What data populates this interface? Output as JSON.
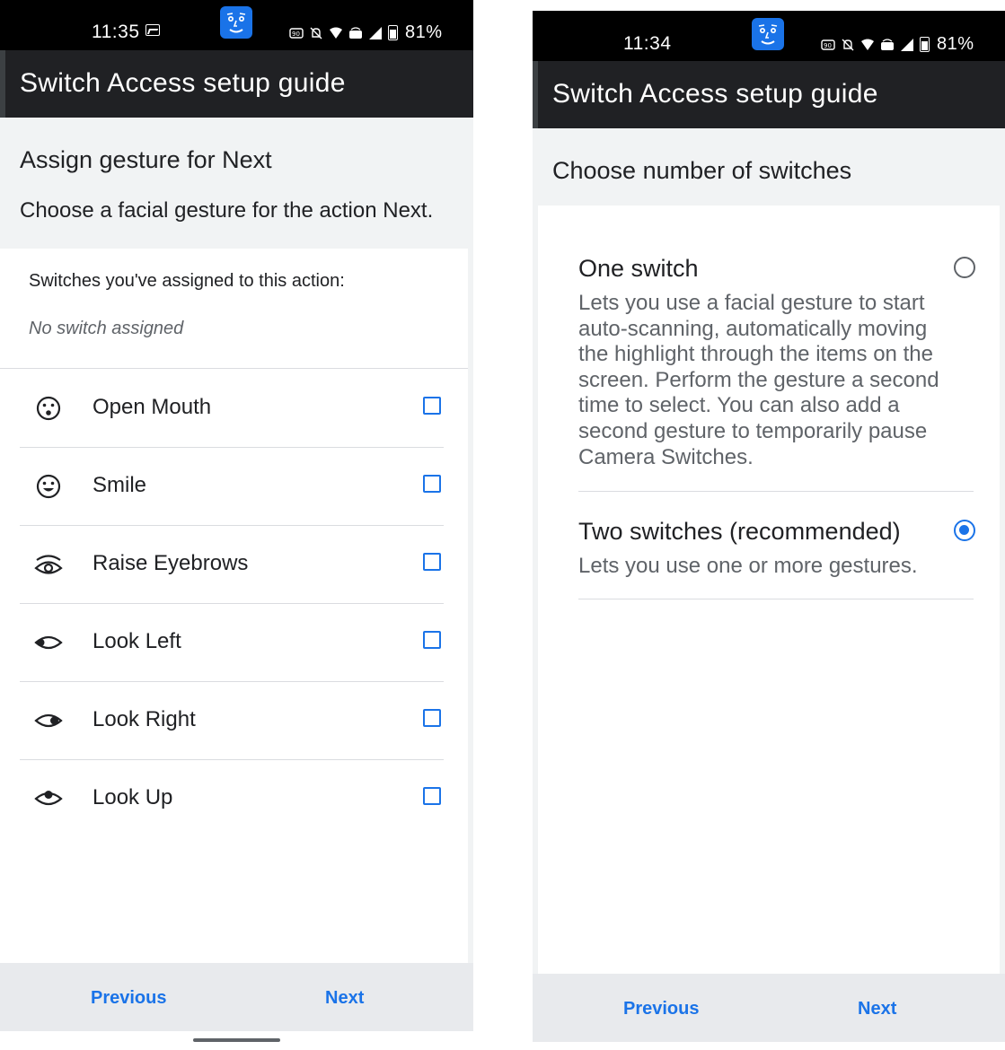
{
  "left_screen": {
    "status_bar": {
      "time": "11:35",
      "battery": "81%"
    },
    "app_bar": {
      "title": "Switch Access setup guide"
    },
    "header": {
      "title": "Assign gesture for Next",
      "description": "Choose a facial gesture for the action Next."
    },
    "assigned": {
      "label": "Switches you've assigned to this action:",
      "value": "No switch assigned"
    },
    "gestures": [
      {
        "label": "Open Mouth",
        "icon": "open-mouth-icon",
        "checked": false
      },
      {
        "label": "Smile",
        "icon": "smile-icon",
        "checked": false
      },
      {
        "label": "Raise Eyebrows",
        "icon": "raise-eyebrows-icon",
        "checked": false
      },
      {
        "label": "Look Left",
        "icon": "look-left-icon",
        "checked": false
      },
      {
        "label": "Look Right",
        "icon": "look-right-icon",
        "checked": false
      },
      {
        "label": "Look Up",
        "icon": "look-up-icon",
        "checked": false
      }
    ],
    "footer": {
      "previous": "Previous",
      "next": "Next"
    }
  },
  "right_screen": {
    "status_bar": {
      "time": "11:34",
      "battery": "81%"
    },
    "app_bar": {
      "title": "Switch Access setup guide"
    },
    "header": {
      "title": "Choose number of switches"
    },
    "options": [
      {
        "title": "One switch",
        "description": "Lets you use a facial gesture to start auto-scanning, automatically moving the highlight through the items on the screen. Perform the gesture a second time to select. You can also add a second gesture to temporarily pause Camera Switches.",
        "selected": false
      },
      {
        "title": "Two switches (recommended)",
        "description": "Lets you use one or more gestures.",
        "selected": true
      }
    ],
    "footer": {
      "previous": "Previous",
      "next": "Next"
    }
  },
  "colors": {
    "accent": "#1a73e8",
    "app_bar": "#202124",
    "header_bg": "#f1f3f4",
    "footer_bg": "#e8eaed"
  }
}
